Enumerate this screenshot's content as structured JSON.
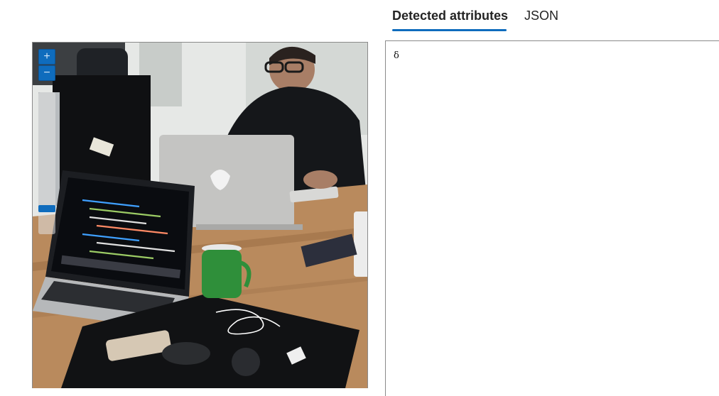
{
  "tabs": [
    {
      "label": "Detected attributes",
      "active": true
    },
    {
      "label": "JSON",
      "active": false
    }
  ],
  "panel": {
    "content": "δ"
  },
  "viewer": {
    "zoom_in_icon": "plus-icon",
    "zoom_out_icon": "minus-icon",
    "accent_color": "#0f6cbd"
  }
}
